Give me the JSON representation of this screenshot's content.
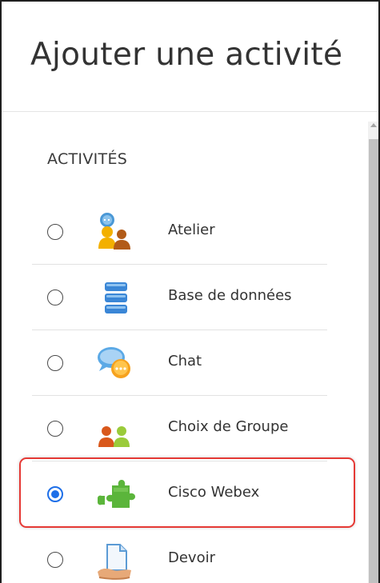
{
  "dialog": {
    "title": "Ajouter une activité"
  },
  "section": {
    "title": "ACTIVITÉS"
  },
  "activities": [
    {
      "label": "Atelier",
      "icon": "workshop-people-icon",
      "selected": false
    },
    {
      "label": "Base de données",
      "icon": "database-icon",
      "selected": false
    },
    {
      "label": "Chat",
      "icon": "chat-bubbles-icon",
      "selected": false
    },
    {
      "label": "Choix de Groupe",
      "icon": "group-choice-icon",
      "selected": false
    },
    {
      "label": "Cisco Webex",
      "icon": "puzzle-plugin-icon",
      "selected": true
    },
    {
      "label": "Devoir",
      "icon": "assignment-icon",
      "selected": false
    }
  ],
  "colors": {
    "accent": "#1e6fe8",
    "highlight_border": "#e53935"
  }
}
